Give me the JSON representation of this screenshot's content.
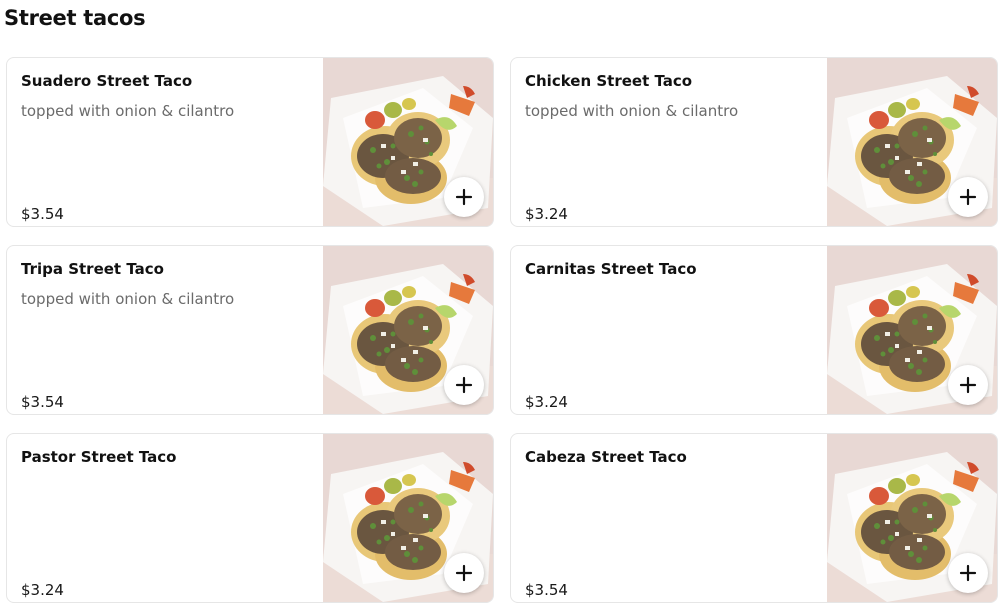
{
  "section": {
    "title": "Street tacos"
  },
  "items": [
    {
      "name": "Suadero Street Taco",
      "description": "topped with onion & cilantro",
      "price": "$3.54",
      "image": "tacos-plate-photo",
      "add_icon": "plus-icon"
    },
    {
      "name": "Chicken Street Taco",
      "description": "topped with onion & cilantro",
      "price": "$3.24",
      "image": "tacos-plate-photo",
      "add_icon": "plus-icon"
    },
    {
      "name": "Tripa Street Taco",
      "description": "topped with onion & cilantro",
      "price": "$3.54",
      "image": "tacos-plate-photo",
      "add_icon": "plus-icon"
    },
    {
      "name": "Carnitas Street Taco",
      "description": "",
      "price": "$3.24",
      "image": "tacos-plate-photo",
      "add_icon": "plus-icon"
    },
    {
      "name": "Pastor Street Taco",
      "description": "",
      "price": "$3.24",
      "image": "tacos-plate-photo",
      "add_icon": "plus-icon"
    },
    {
      "name": "Cabeza Street Taco",
      "description": "",
      "price": "$3.54",
      "image": "tacos-plate-photo",
      "add_icon": "plus-icon"
    }
  ],
  "colors": {
    "background": "#ffffff",
    "card_border": "#e6e6e6",
    "text_primary": "#111111",
    "text_secondary": "#6b6b6b"
  }
}
